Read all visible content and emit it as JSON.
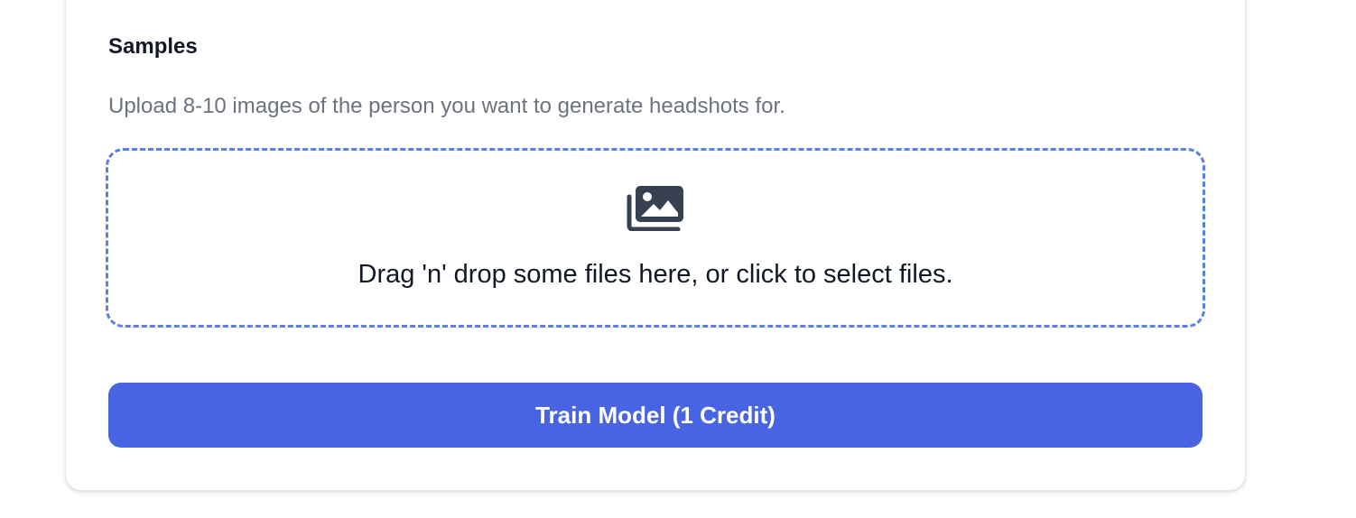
{
  "samples": {
    "title": "Samples",
    "description": "Upload 8-10 images of the person you want to generate headshots for."
  },
  "dropzone": {
    "icon": "images-icon",
    "text": "Drag 'n' drop some files here, or click to select files.",
    "border_color": "#5b7fe6"
  },
  "train_button": {
    "label": "Train Model (1 Credit)",
    "color": "#4964e2"
  }
}
